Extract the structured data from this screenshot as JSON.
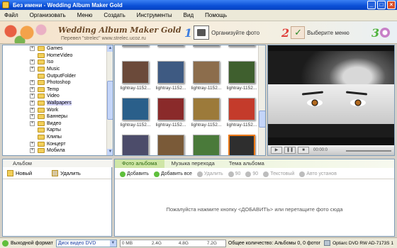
{
  "window": {
    "title": "Без имени - Wedding Album Maker Gold",
    "controls": [
      "_",
      "□",
      "×"
    ]
  },
  "menu": [
    "Файл",
    "Организовать",
    "Меню",
    "Создать",
    "Инструменты",
    "Вид",
    "Помощь"
  ],
  "banner": {
    "title": "Wedding Album Maker Gold",
    "subtitle": "Перевел \"strelec\"   www.strelec.ucoz.ru",
    "steps": [
      {
        "num": "1",
        "label": "Организуйте фото",
        "icon": "camera-icon"
      },
      {
        "num": "2",
        "label": "Выберите меню",
        "icon": "checkmark-icon"
      },
      {
        "num": "3",
        "label": "",
        "icon": "disc-icon"
      }
    ]
  },
  "folders": [
    {
      "label": "Games",
      "expand": "+"
    },
    {
      "label": "HomeVideo",
      "expand": ""
    },
    {
      "label": "Iso",
      "expand": "+"
    },
    {
      "label": "Music",
      "expand": "+"
    },
    {
      "label": "OutputFolder",
      "expand": ""
    },
    {
      "label": "Photoshop",
      "expand": "+"
    },
    {
      "label": "Temp",
      "expand": "+"
    },
    {
      "label": "Video",
      "expand": "+"
    },
    {
      "label": "Wallpapers",
      "expand": "+"
    },
    {
      "label": "Work",
      "expand": "+"
    },
    {
      "label": "Баннеры",
      "expand": "+"
    },
    {
      "label": "Видео",
      "expand": "+"
    },
    {
      "label": "Карты",
      "expand": ""
    },
    {
      "label": "Клипы",
      "expand": ""
    },
    {
      "label": "Концерт",
      "expand": "+"
    },
    {
      "label": "Мобила",
      "expand": "+"
    },
    {
      "label": "Музыка_сорт",
      "expand": "+"
    }
  ],
  "thumbnails": [
    {
      "caption": "lightray-1152...",
      "color": "#6b4a3a"
    },
    {
      "caption": "lightray-1152...",
      "color": "#3e5a82"
    },
    {
      "caption": "lightray-1152...",
      "color": "#8c6d4c"
    },
    {
      "caption": "lightray-1152...",
      "color": "#3f5f2e"
    },
    {
      "caption": "lightray-1152...",
      "color": "#2a5f8a"
    },
    {
      "caption": "lightray-1152...",
      "color": "#8a2a2a"
    },
    {
      "caption": "lightray-1152...",
      "color": "#9c7a3a"
    },
    {
      "caption": "lightray-1152...",
      "color": "#c43b2b"
    },
    {
      "caption": "lightray-1152...",
      "color": "#4c4c6a"
    },
    {
      "caption": "lightray-1152...",
      "color": "#7a5a38"
    },
    {
      "caption": "lightray-1152...",
      "color": "#4a7a3a"
    },
    {
      "caption": "lightray-1152...",
      "color": "#2e2e2e"
    }
  ],
  "preview": {
    "time": "00:00:0",
    "controls": [
      "play-icon",
      "pause-icon",
      "stop-icon"
    ]
  },
  "album": {
    "tab": "Альбом",
    "new_label": "Новый",
    "delete_label": "Удалить"
  },
  "tabs": [
    "Фото альбома",
    "Музыка перехода",
    "Тема альбома"
  ],
  "toolbar": [
    {
      "label": "Добавить",
      "disabled": false
    },
    {
      "label": "Добавить все",
      "disabled": false
    },
    {
      "label": "Удалить",
      "disabled": true
    },
    {
      "label": "90",
      "disabled": true
    },
    {
      "label": "90",
      "disabled": true
    },
    {
      "label": "Текстовый",
      "disabled": true
    },
    {
      "label": "Авто установ",
      "disabled": true
    }
  ],
  "hint": "Пожалуйста нажмите кнопку <ДОБАВИТЬ> или перетащите  фото сюда",
  "status": {
    "format_label": "Выходной формат",
    "format_value": "Диск видео DVD",
    "scale": [
      "0 MB",
      "2.4G",
      "4.8G",
      "7.2G"
    ],
    "summary": "Общее количество: Альбомы 0, 0 фотог",
    "drive": "Optiarc DVD RW AD-7173S 1"
  }
}
